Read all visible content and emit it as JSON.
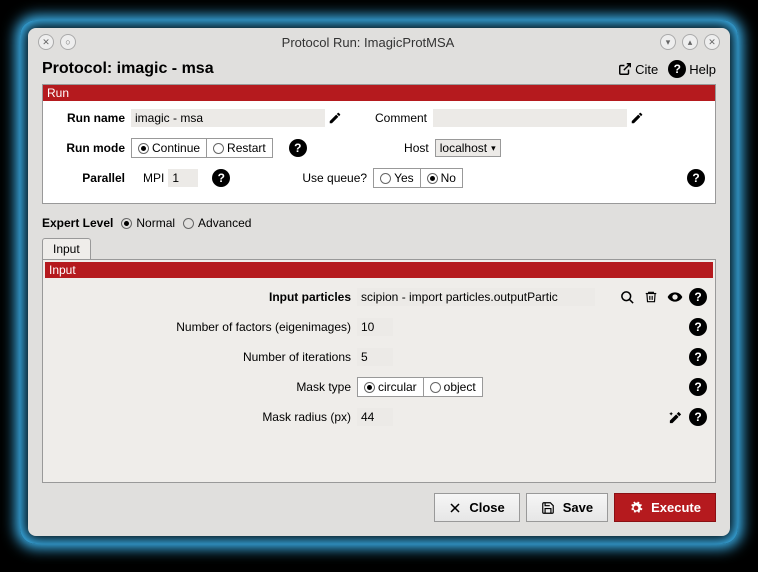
{
  "window": {
    "title": "Protocol Run: ImagicProtMSA"
  },
  "header": {
    "protocol_title": "Protocol: imagic - msa",
    "cite": "Cite",
    "help": "Help"
  },
  "run": {
    "section_title": "Run",
    "run_name_label": "Run name",
    "run_name": "imagic - msa",
    "comment_label": "Comment",
    "comment": "",
    "run_mode_label": "Run mode",
    "mode_continue": "Continue",
    "mode_restart": "Restart",
    "host_label": "Host",
    "host": "localhost",
    "parallel_label": "Parallel",
    "mpi_label": "MPI",
    "mpi": "1",
    "queue_label": "Use queue?",
    "yes": "Yes",
    "no": "No"
  },
  "expert": {
    "label": "Expert Level",
    "normal": "Normal",
    "advanced": "Advanced"
  },
  "input": {
    "tab_label": "Input",
    "section_title": "Input",
    "particles_label": "Input particles",
    "particles": "scipion - import particles.outputPartic",
    "factors_label": "Number of factors (eigenimages)",
    "factors": "10",
    "iterations_label": "Number of iterations",
    "iterations": "5",
    "mask_type_label": "Mask type",
    "mask_circular": "circular",
    "mask_object": "object",
    "mask_radius_label": "Mask radius (px)",
    "mask_radius": "44"
  },
  "footer": {
    "close": "Close",
    "save": "Save",
    "execute": "Execute"
  }
}
